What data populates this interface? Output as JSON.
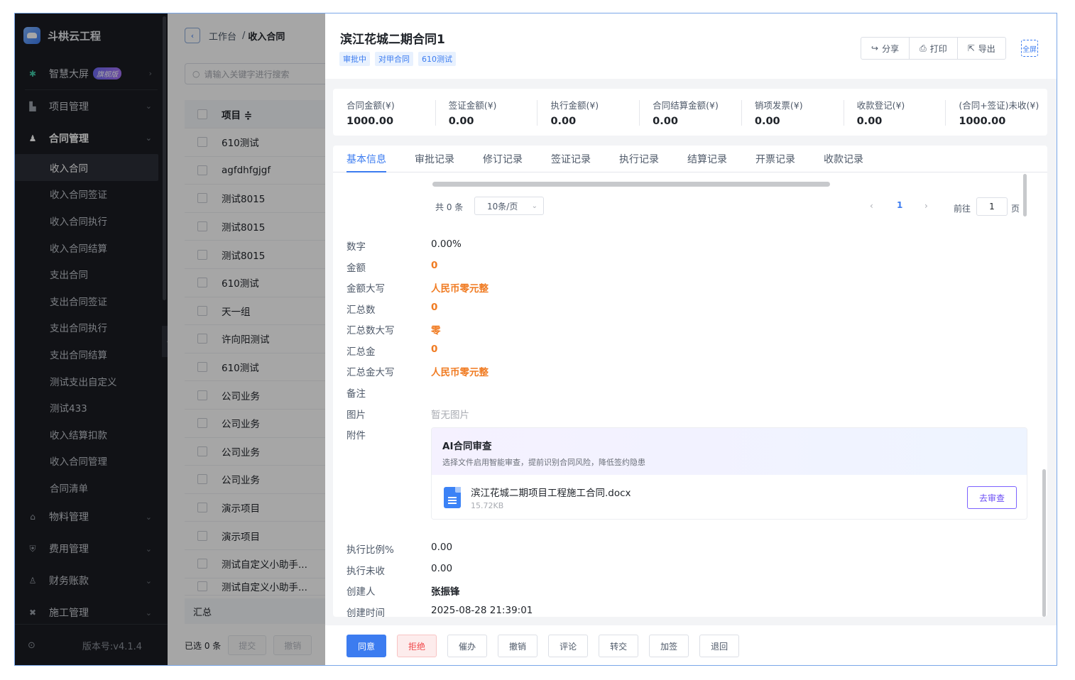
{
  "app": {
    "name": "斗栱云工程",
    "version": "版本号:v4.1.4"
  },
  "sidebar": {
    "items": [
      {
        "label": "智慧大屏",
        "badge": "旗舰版",
        "icon": "dashboard-icon"
      },
      {
        "label": "项目管理",
        "icon": "building-icon"
      },
      {
        "label": "合同管理",
        "icon": "user-icon"
      }
    ],
    "subitems": [
      "收入合同",
      "收入合同签证",
      "收入合同执行",
      "收入合同结算",
      "支出合同",
      "支出合同签证",
      "支出合同执行",
      "支出合同结算",
      "测试支出自定义",
      "测试433",
      "收入结算扣款",
      "收入合同管理",
      "合同清单"
    ],
    "bottom_items": [
      {
        "label": "物料管理",
        "icon": "warehouse-icon"
      },
      {
        "label": "费用管理",
        "icon": "shield-icon"
      },
      {
        "label": "财务账款",
        "icon": "finance-icon"
      },
      {
        "label": "施工管理",
        "icon": "tools-icon"
      }
    ]
  },
  "list": {
    "breadcrumb_home": "工作台",
    "breadcrumb_sep": "/",
    "breadcrumb_current": "收入合同",
    "search_placeholder": "请输入关键字进行搜索",
    "column_header": "项目 ≑",
    "rows": [
      "610测试",
      "agfdhfgjgf",
      "测试8015",
      "测试8015",
      "测试8015",
      "610测试",
      "天一组",
      "许向阳测试",
      "610测试",
      "公司业务",
      "公司业务",
      "公司业务",
      "公司业务",
      "演示项目",
      "演示项目",
      "测试自定义小助手...",
      "测试自定义小助手..."
    ],
    "summary": "汇总",
    "selected": "已选 0 条",
    "submit": "提交",
    "revoke": "撤销"
  },
  "drawer": {
    "title": "滨江花城二期合同1",
    "tags": [
      "审批中",
      "对甲合同",
      "610测试"
    ],
    "actions": {
      "share": "分享",
      "print": "打印",
      "export": "导出",
      "fullscreen": "全屏"
    },
    "stats": [
      {
        "label": "合同金额(¥)",
        "value": "1000.00"
      },
      {
        "label": "签证金额(¥)",
        "value": "0.00"
      },
      {
        "label": "执行金额(¥)",
        "value": "0.00"
      },
      {
        "label": "合同结算金额(¥)",
        "value": "0.00"
      },
      {
        "label": "销项发票(¥)",
        "value": "0.00"
      },
      {
        "label": "收款登记(¥)",
        "value": "0.00"
      },
      {
        "label": "(合同+签证)未收(¥)",
        "value": "1000.00"
      }
    ],
    "tabs": [
      "基本信息",
      "审批记录",
      "修订记录",
      "签证记录",
      "执行记录",
      "结算记录",
      "开票记录",
      "收款记录"
    ],
    "pager": {
      "total": "共 0 条",
      "size": "10条/页",
      "current": "1",
      "goto": "前往",
      "goto_value": "1",
      "page": "页"
    },
    "fields": [
      {
        "label": "数字",
        "value": "0.00%"
      },
      {
        "label": "金额",
        "value": "0"
      },
      {
        "label": "金额大写",
        "value": "人民币零元整"
      },
      {
        "label": "汇总数",
        "value": "0"
      },
      {
        "label": "汇总数大写",
        "value": "零"
      },
      {
        "label": "汇总金",
        "value": "0"
      },
      {
        "label": "汇总金大写",
        "value": "人民币零元整"
      },
      {
        "label": "备注",
        "value": ""
      },
      {
        "label": "图片",
        "value": "暂无图片"
      },
      {
        "label": "附件",
        "value": ""
      }
    ],
    "ai": {
      "title": "AI合同审查",
      "desc": "选择文件启用智能审查，提前识别合同风险，降低签约隐患",
      "file_name": "滨江花城二期项目工程施工合同.docx",
      "file_size": "15.72KB",
      "review_button": "去审查"
    },
    "fields_after": [
      {
        "label": "执行比例%",
        "value": "0.00"
      },
      {
        "label": "执行未收",
        "value": "0.00"
      },
      {
        "label": "创建人",
        "value": "张振锋"
      },
      {
        "label": "创建时间",
        "value": "2025-08-28 21:39:01"
      }
    ],
    "footer_buttons": [
      "同意",
      "拒绝",
      "催办",
      "撤销",
      "评论",
      "转交",
      "加签",
      "退回"
    ]
  },
  "colors": {
    "accent": "#3c7cf0",
    "sidebar_bg": "#1b1d22",
    "orange": "#f07b22",
    "danger": "#f0484a"
  }
}
